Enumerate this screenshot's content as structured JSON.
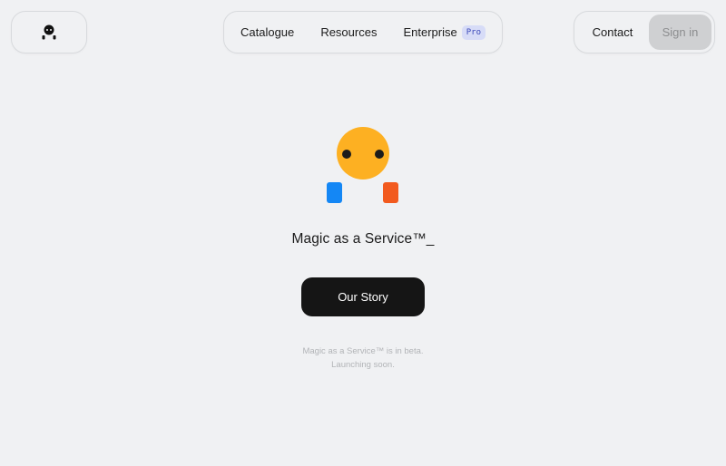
{
  "header": {
    "logo_icon": "mascot-logo-icon",
    "nav": {
      "catalogue": "Catalogue",
      "resources": "Resources",
      "enterprise": "Enterprise",
      "enterprise_badge": "Pro"
    },
    "contact": "Contact",
    "sign_in": "Sign in"
  },
  "hero": {
    "mascot_icon": "mascot-illustration",
    "tagline": "Magic as a Service™_",
    "cta_label": "Our Story",
    "note_line1": "Magic as a Service™ is in beta.",
    "note_line2": "Launching soon."
  },
  "colors": {
    "background": "#f0f1f3",
    "mascot_head": "#fdb022",
    "mascot_left_hand": "#1487f5",
    "mascot_right_hand": "#f25a1e",
    "cta_bg": "#151515",
    "badge_bg": "#d7dcf7",
    "badge_text": "#3a47b8"
  }
}
